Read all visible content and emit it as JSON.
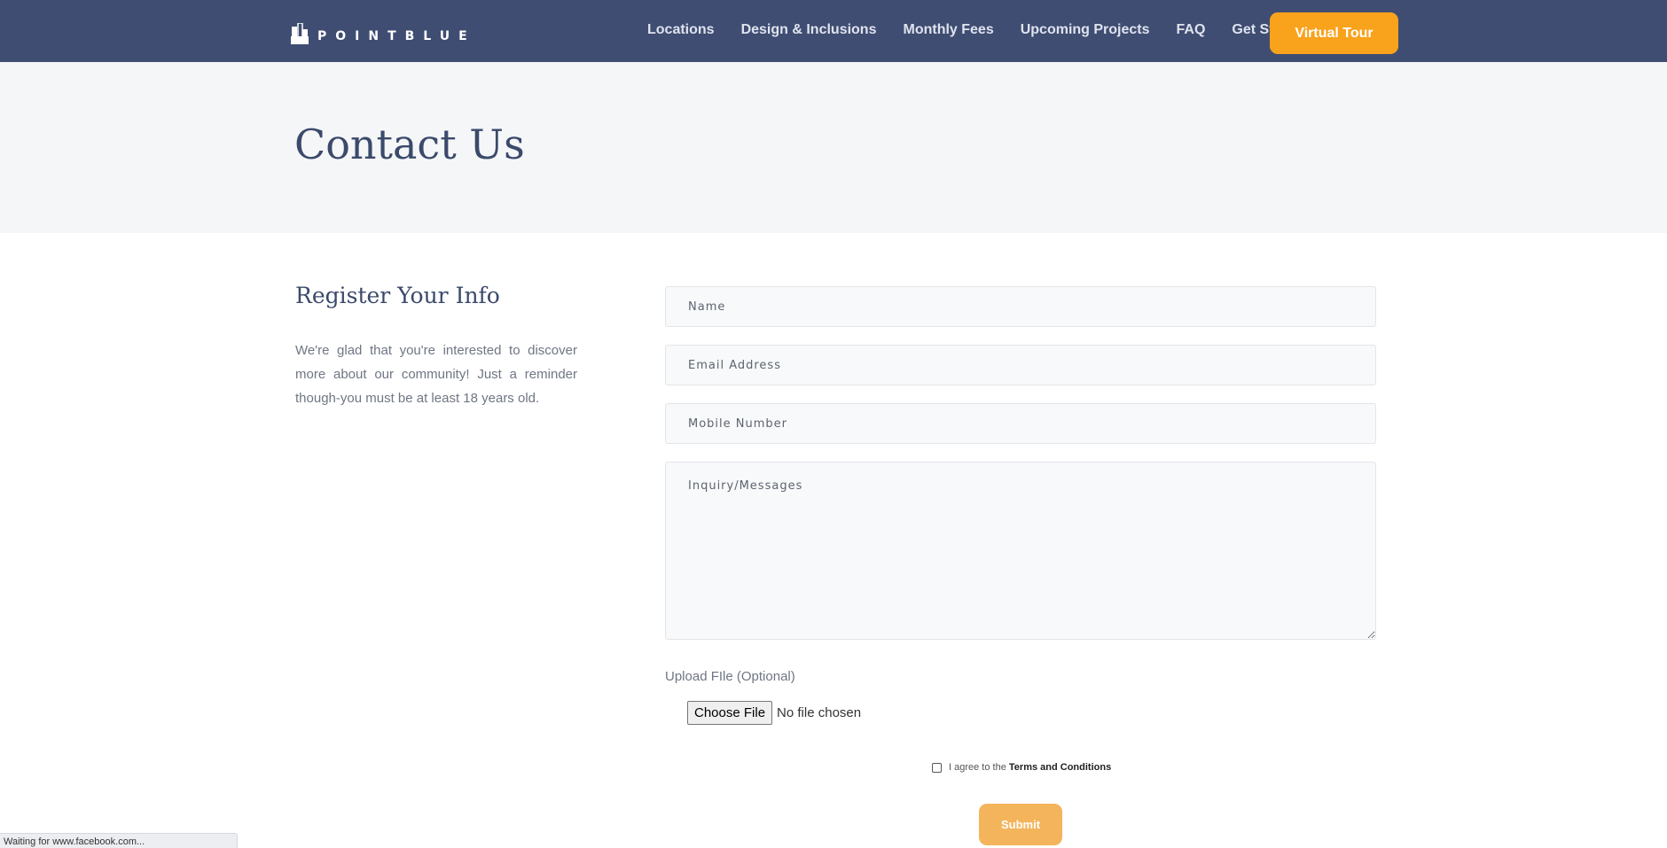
{
  "header": {
    "logo_text": "POINTBLUE",
    "nav_items": [
      {
        "label": "Locations"
      },
      {
        "label": "Design & Inclusions"
      },
      {
        "label": "Monthly Fees"
      },
      {
        "label": "Upcoming Projects"
      },
      {
        "label": "FAQ"
      },
      {
        "label": "Get Started"
      }
    ],
    "cta_label": "Virtual Tour"
  },
  "hero": {
    "title": "Contact Us"
  },
  "info": {
    "heading": "Register Your Info",
    "text": "We're glad that you're interested to discover more about our community! Just a reminder though-you must be at least 18 years old."
  },
  "form": {
    "name_placeholder": "Name",
    "email_placeholder": "Email Address",
    "mobile_placeholder": "Mobile Number",
    "message_placeholder": "Inquiry/Messages",
    "upload_label": "Upload FIle (Optional)",
    "choose_file_label": "Choose File",
    "file_status": "No file chosen",
    "terms_prefix": "I agree to the ",
    "terms_link": "Terms and Conditions",
    "terms_checked": false,
    "submit_label": "Submit"
  },
  "statusbar": {
    "text": "Waiting for www.facebook.com..."
  },
  "colors": {
    "nav_bg": "#3f4d72",
    "accent": "#f9a21c",
    "submit": "#f4b45c",
    "heading": "#3b4a6b",
    "hero_bg": "#f5f6f8"
  },
  "icons": {
    "logo": "building-logo-icon"
  }
}
